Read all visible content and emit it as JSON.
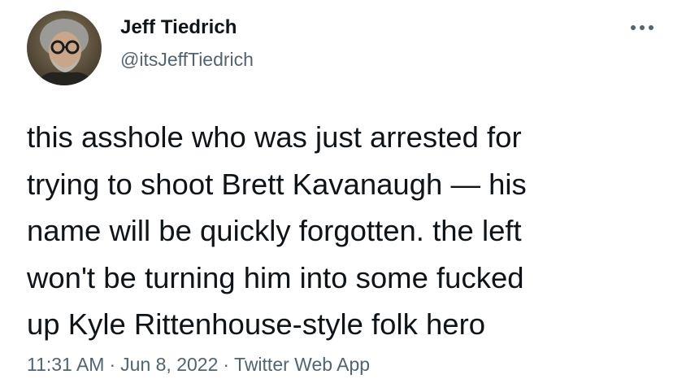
{
  "author": {
    "display_name": "Jeff Tiedrich",
    "handle": "@itsJeffTiedrich"
  },
  "tweet": {
    "text": "this asshole who was just arrested for\ntrying to shoot Brett Kavanaugh — his\nname will be quickly forgotten. the left\nwon't be turning him into some fucked\nup Kyle Rittenhouse-style folk hero"
  },
  "meta": {
    "time": "11:31 AM",
    "separator": "·",
    "date": "Jun 8, 2022",
    "source": "Twitter Web App"
  },
  "icons": {
    "more": "more-horizontal-icon"
  },
  "colors": {
    "text_primary": "#0f1419",
    "text_secondary": "#536471",
    "background": "#ffffff"
  }
}
